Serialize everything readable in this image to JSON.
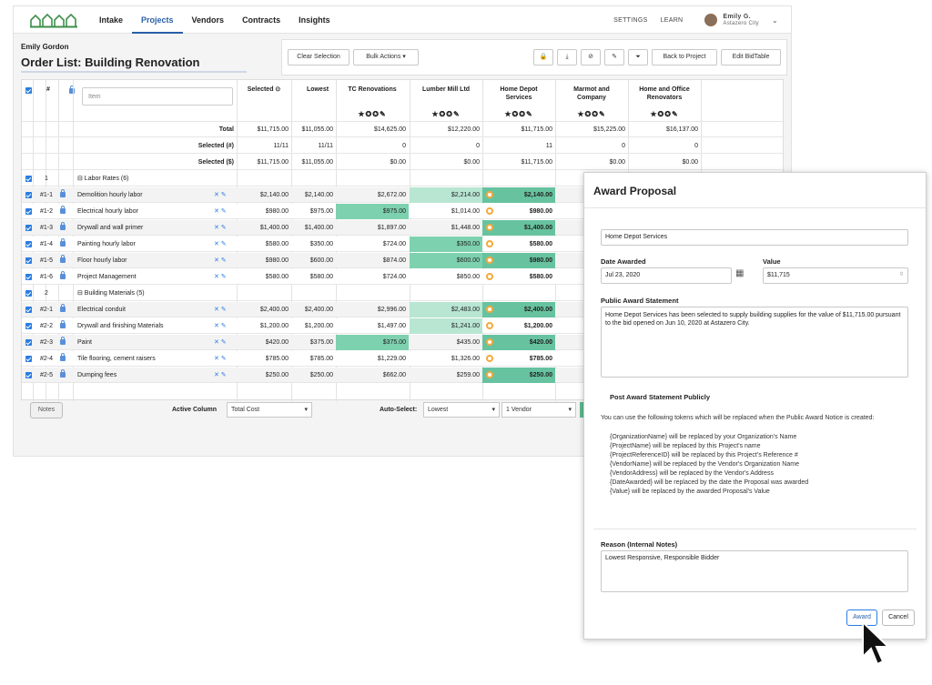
{
  "nav": {
    "tabs": [
      "Intake",
      "Projects",
      "Vendors",
      "Contracts",
      "Insights"
    ],
    "active": "Projects",
    "settings": "SETTINGS",
    "learn": "LEARN",
    "user_name": "Emily G.",
    "user_org": "Astazero City"
  },
  "page": {
    "user": "Emily Gordon",
    "title": "Order List: Building Renovation"
  },
  "toolbar": {
    "clear": "Clear Selection",
    "bulk": "Bulk Actions",
    "back": "Back to Project",
    "edit": "Edit BidTable"
  },
  "grid": {
    "headers": {
      "hash": "#",
      "item_placeholder": "Item",
      "selected": "Selected ⊙",
      "lowest": "Lowest"
    },
    "vendors": [
      "TC Renovations",
      "Lumber Mill Ltd",
      "Home Depot Services",
      "Marmot and Company",
      "Home and Office Renovators"
    ],
    "summary": [
      {
        "label": "Total",
        "selected": "$11,715.00",
        "lowest": "$11,055.00",
        "v": [
          "$14,625.00",
          "$12,220.00",
          "$11,715.00",
          "$15,225.00",
          "$16,137.00"
        ]
      },
      {
        "label": "Selected (#)",
        "selected": "11/11",
        "lowest": "11/11",
        "v": [
          "0",
          "0",
          "11",
          "0",
          "0"
        ]
      },
      {
        "label": "Selected ($)",
        "selected": "$11,715.00",
        "lowest": "$11,055.00",
        "v": [
          "$0.00",
          "$0.00",
          "$11,715.00",
          "$0.00",
          "$0.00"
        ]
      }
    ],
    "groups": [
      {
        "num": "1",
        "name": "⊟ Labor Rates (6)",
        "items": [
          {
            "id": "#1-1",
            "name": "Demolition hourly labor",
            "sel": "$2,140.00",
            "low": "$2,140.00",
            "tc": "$2,672.00",
            "lm": "$2,214.00",
            "hd": "$2,140.00"
          },
          {
            "id": "#1-2",
            "name": "Electrical hourly labor",
            "sel": "$980.00",
            "low": "$975.00",
            "tc": "$975.00",
            "lm": "$1,014.00",
            "hd": "$980.00"
          },
          {
            "id": "#1-3",
            "name": "Drywall and wall primer",
            "sel": "$1,400.00",
            "low": "$1,400.00",
            "tc": "$1,897.00",
            "lm": "$1,448.00",
            "hd": "$1,400.00"
          },
          {
            "id": "#1-4",
            "name": "Painting hourly labor",
            "sel": "$580.00",
            "low": "$350.00",
            "tc": "$724.00",
            "lm": "$350.00",
            "hd": "$580.00"
          },
          {
            "id": "#1-5",
            "name": "Floor hourly labor",
            "sel": "$980.00",
            "low": "$600.00",
            "tc": "$874.00",
            "lm": "$600.00",
            "hd": "$980.00"
          },
          {
            "id": "#1-6",
            "name": "Project Management",
            "sel": "$580.00",
            "low": "$580.00",
            "tc": "$724.00",
            "lm": "$850.00",
            "hd": "$580.00"
          }
        ]
      },
      {
        "num": "2",
        "name": "⊟ Building Materials (5)",
        "items": [
          {
            "id": "#2-1",
            "name": "Electrical conduit",
            "sel": "$2,400.00",
            "low": "$2,400.00",
            "tc": "$2,996.00",
            "lm": "$2,483.00",
            "hd": "$2,400.00"
          },
          {
            "id": "#2-2",
            "name": "Drywall and finishing Materials",
            "sel": "$1,200.00",
            "low": "$1,200.00",
            "tc": "$1,497.00",
            "lm": "$1,241.00",
            "hd": "$1,200.00"
          },
          {
            "id": "#2-3",
            "name": "Paint",
            "sel": "$420.00",
            "low": "$375.00",
            "tc": "$375.00",
            "lm": "$435.00",
            "hd": "$420.00"
          },
          {
            "id": "#2-4",
            "name": "Tile flooring, cement raisers",
            "sel": "$785.00",
            "low": "$785.00",
            "tc": "$1,229.00",
            "lm": "$1,326.00",
            "hd": "$785.00"
          },
          {
            "id": "#2-5",
            "name": "Dumping fees",
            "sel": "$250.00",
            "low": "$250.00",
            "tc": "$662.00",
            "lm": "$259.00",
            "hd": "$250.00"
          }
        ]
      }
    ]
  },
  "bottom": {
    "notes": "Notes",
    "active_col_label": "Active Column",
    "active_col": "Total Cost",
    "auto_label": "Auto-Select:",
    "auto": "Lowest",
    "vendors": "1 Vendor"
  },
  "modal": {
    "title": "Award Proposal",
    "vendor": "Home Depot Services",
    "date_label": "Date Awarded",
    "date": "Jul 23, 2020",
    "value_label": "Value",
    "value": "$11,715",
    "statement_label": "Public Award Statement",
    "statement": "Home Depot Services has been selected to supply building supplies for the value of $11,715.00 pursuant to the bid opened on Jun 10, 2020 at Astazero City.",
    "post_label": "Post Award Statement Publicly",
    "help": "You can use the following tokens which will be replaced when the Public Award Notice is created:",
    "tokens": [
      "{OrganizationName} will be replaced by your Organization's Name",
      "{ProjectName} will be replaced by this Project's name",
      "{ProjectReferenceID} will be replaced by this Project's Reference #",
      "{VendorName} will be replaced by the Vendor's Organization Name",
      "{VendorAddress} will be replaced by the Vendor's Address",
      "{DateAwarded} will be replaced by the date the Proposal was awarded",
      "{Value} will be replaced by the awarded Proposal's Value"
    ],
    "reason_label": "Reason (Internal Notes)",
    "reason": "Lowest Responsive, Responsible Bidder",
    "award": "Award",
    "cancel": "Cancel"
  }
}
